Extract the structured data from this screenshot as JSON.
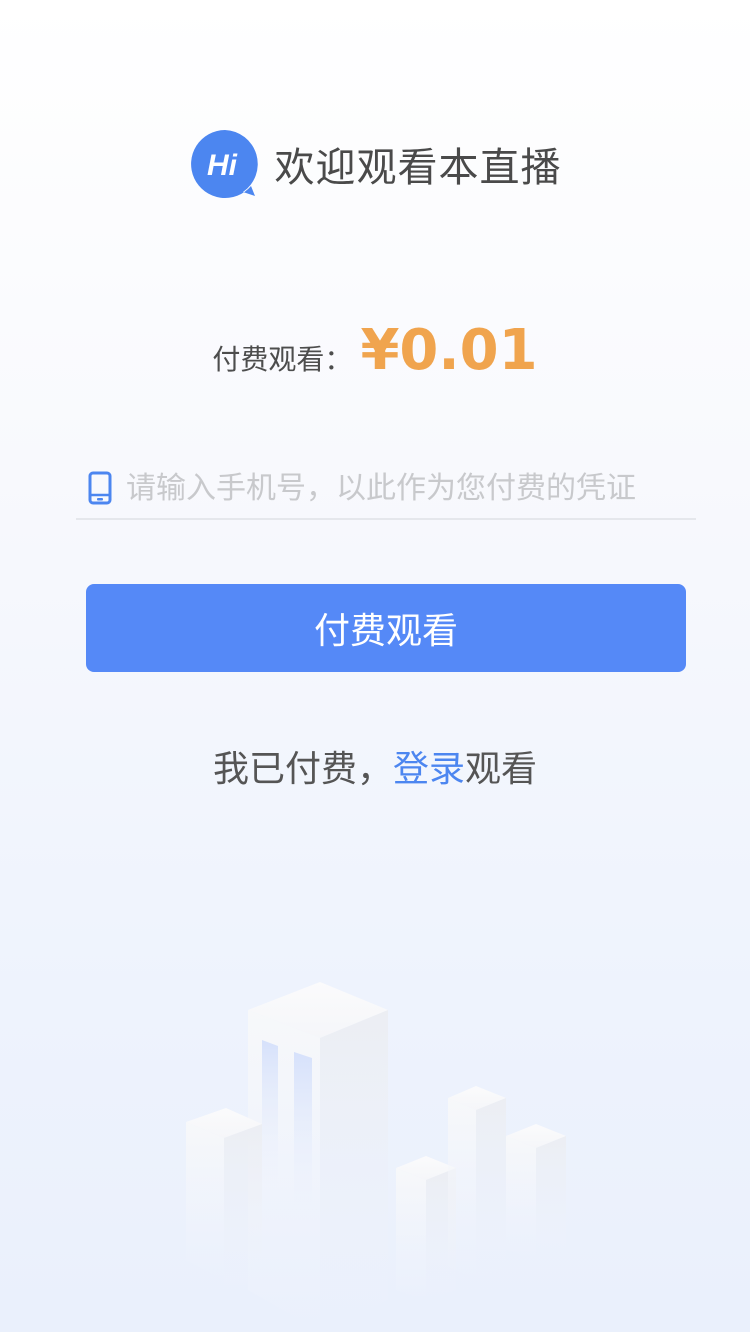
{
  "header": {
    "badge_text": "Hi",
    "title": "欢迎观看本直播"
  },
  "price": {
    "label": "付费观看：",
    "value": "¥0.01",
    "color": "#f0a44e"
  },
  "phone": {
    "icon": "mobile-phone-icon",
    "value": "",
    "placeholder": "请输入手机号，以此作为您付费的凭证"
  },
  "pay_button": {
    "label": "付费观看",
    "color": "#5589f7"
  },
  "paid_row": {
    "prefix": "我已付费，",
    "link": "登录",
    "suffix": "观看",
    "link_color": "#4c86f0"
  },
  "decoration": {
    "illustration": "city-buildings-illustration"
  }
}
